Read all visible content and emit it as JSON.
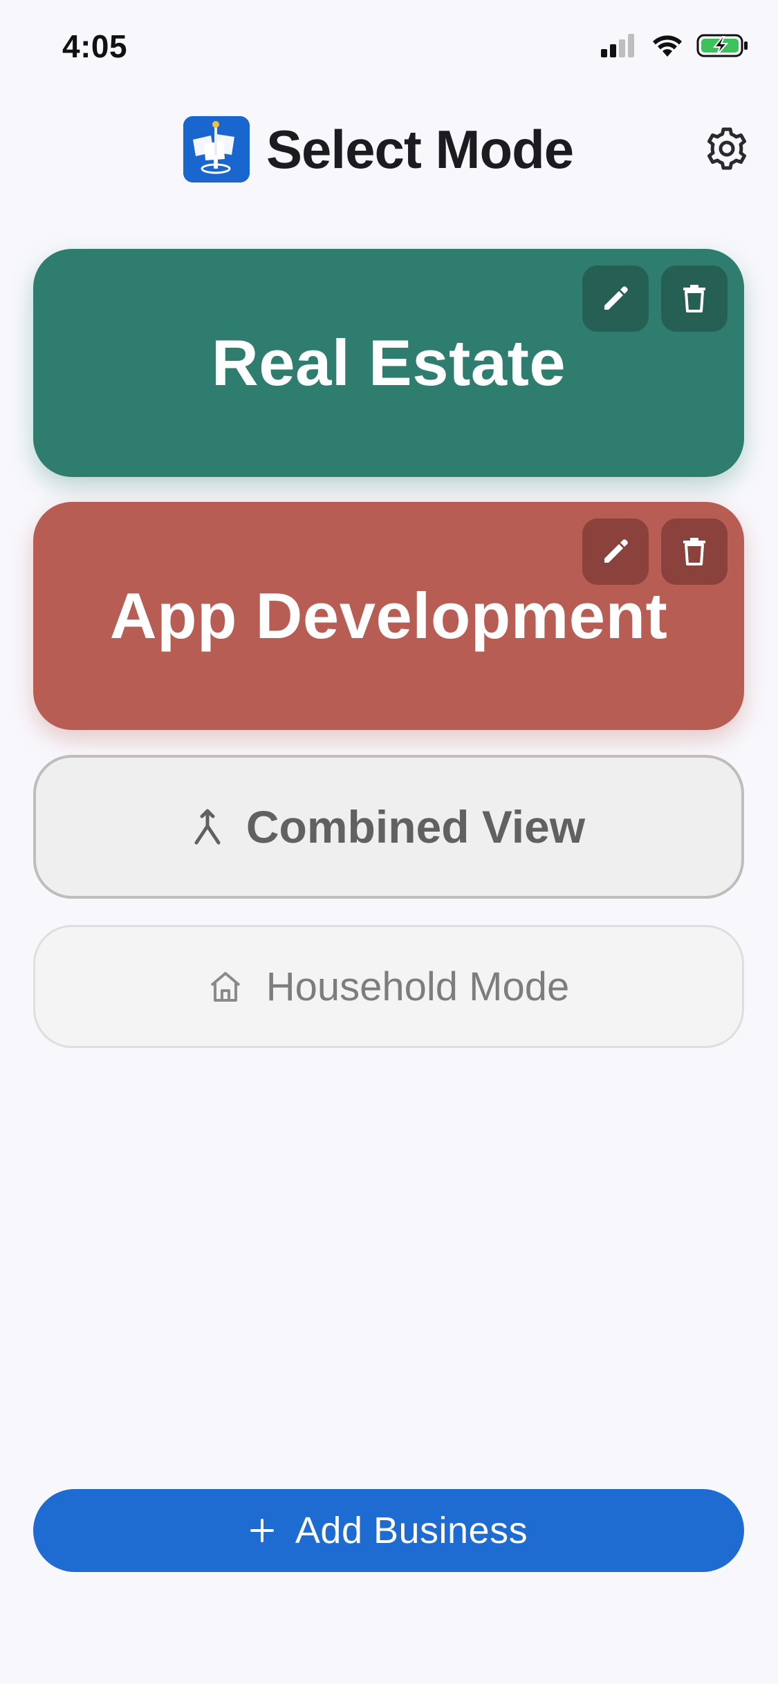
{
  "status_bar": {
    "time": "4:05",
    "icons": [
      "cellular-signal-icon",
      "wifi-icon",
      "battery-charging-icon"
    ]
  },
  "header": {
    "title": "Select Mode",
    "logo_icon": "app-logo-icon",
    "settings_icon": "gear-icon"
  },
  "businesses": [
    {
      "name": "Real Estate",
      "color": "#2e7d6e",
      "actions": [
        "pencil-icon",
        "trash-icon"
      ]
    },
    {
      "name": "App Development",
      "color": "#b85d54",
      "actions": [
        "pencil-icon",
        "trash-icon"
      ]
    }
  ],
  "combined_view": {
    "label": "Combined View",
    "icon": "merge-icon"
  },
  "household_mode": {
    "label": "Household Mode",
    "icon": "house-icon"
  },
  "add_business": {
    "label": "Add Business",
    "icon": "plus-icon",
    "color": "#1e6bd1"
  }
}
